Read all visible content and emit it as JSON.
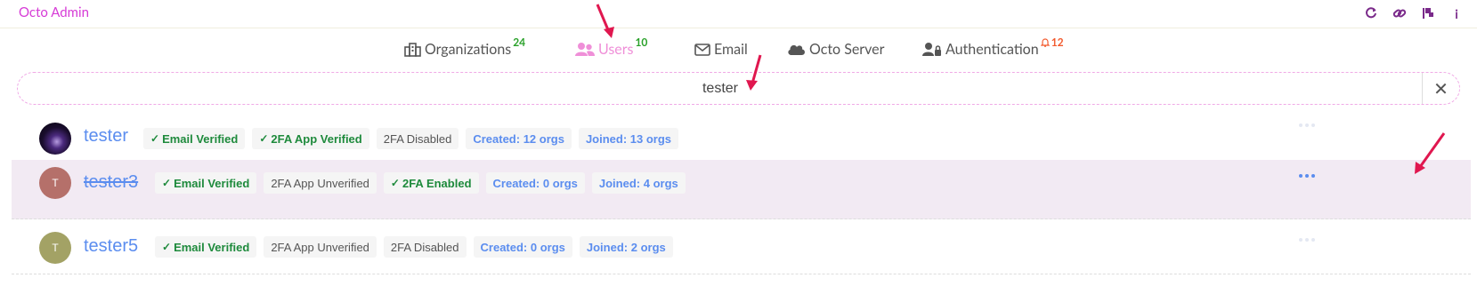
{
  "app": {
    "title": "Octo Admin"
  },
  "top_icons": [
    "refresh-icon",
    "link-icon",
    "flag-icon",
    "info-icon"
  ],
  "nav": {
    "items": [
      {
        "label": "Organizations",
        "badge": "24",
        "icon": "organization-icon"
      },
      {
        "label": "Users",
        "badge": "10",
        "icon": "users-icon",
        "active": true
      },
      {
        "label": "Email",
        "icon": "email-icon"
      },
      {
        "label": "Octo Server",
        "icon": "cloud-icon"
      },
      {
        "label": "Authentication",
        "badge": "12",
        "icon": "user-lock-icon"
      }
    ]
  },
  "search": {
    "value": "tester",
    "clear_icon": "close-icon"
  },
  "users": [
    {
      "initial": "",
      "name": "tester",
      "deleted": false,
      "avatar_color": "#1a0d2e",
      "tags": [
        "Email Verified",
        "2FA App Verified",
        "2FA Disabled",
        "Created: 12 orgs",
        "Joined: 13 orgs"
      ]
    },
    {
      "initial": "T",
      "name": "tester3",
      "deleted": true,
      "avatar_color": "#b5706a",
      "tags": [
        "Email Verified",
        "2FA App Unverified",
        "2FA Enabled",
        "Created: 0 orgs",
        "Joined: 4 orgs"
      ]
    },
    {
      "initial": "T",
      "name": "tester5",
      "deleted": false,
      "avatar_color": "#a3a265",
      "tags": [
        "Email Verified",
        "2FA App Unverified",
        "2FA Disabled",
        "Created: 0 orgs",
        "Joined: 2 orgs"
      ]
    }
  ],
  "colors": {
    "accent": "#d63bd6",
    "link": "#5b8def",
    "highlight_row": "#f2eaf3",
    "arrow": "#e0174f"
  }
}
